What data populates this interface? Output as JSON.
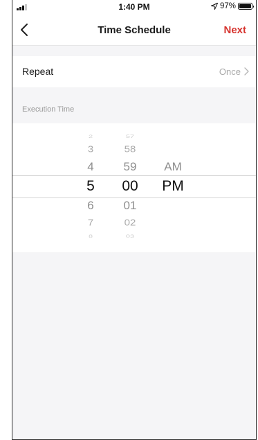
{
  "status_bar": {
    "time": "1:40 PM",
    "battery": "97%"
  },
  "nav": {
    "title": "Time Schedule",
    "next": "Next"
  },
  "repeat": {
    "label": "Repeat",
    "value": "Once"
  },
  "section_label": "Execution Time",
  "picker": {
    "hours": {
      "items": [
        "2",
        "3",
        "4",
        "5",
        "6",
        "7",
        "8"
      ],
      "selected_index": 3
    },
    "minutes": {
      "items": [
        "57",
        "58",
        "59",
        "00",
        "01",
        "02",
        "03"
      ],
      "selected_index": 3
    },
    "ampm": {
      "items": [
        "AM",
        "PM"
      ],
      "selected_index": 1
    }
  },
  "colors": {
    "accent": "#d6332e",
    "background": "#f5f5f7"
  }
}
